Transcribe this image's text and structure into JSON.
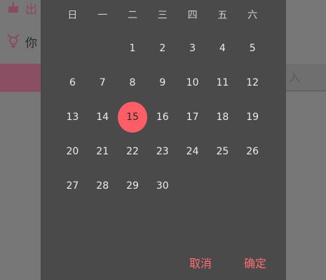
{
  "background": {
    "row1_text": "出",
    "row2_text": "你",
    "band_right_glyph": "入"
  },
  "calendar": {
    "weekdays": [
      "日",
      "一",
      "二",
      "三",
      "四",
      "五",
      "六"
    ],
    "weeks": [
      [
        "",
        "",
        "1",
        "2",
        "3",
        "4",
        "5"
      ],
      [
        "6",
        "7",
        "8",
        "9",
        "10",
        "11",
        "12"
      ],
      [
        "13",
        "14",
        "15",
        "16",
        "17",
        "18",
        "19"
      ],
      [
        "20",
        "21",
        "22",
        "23",
        "24",
        "25",
        "26"
      ],
      [
        "27",
        "28",
        "29",
        "30",
        "",
        "",
        ""
      ]
    ],
    "selected_day": "15"
  },
  "actions": {
    "cancel_label": "取消",
    "ok_label": "确定"
  },
  "colors": {
    "accent": "#ff5e66",
    "dialog_bg": "#4a4a4a"
  }
}
